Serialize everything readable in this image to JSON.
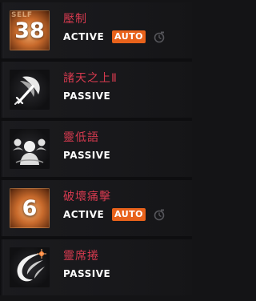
{
  "skills": [
    {
      "name": "壓制",
      "type": "ACTIVE",
      "auto": "AUTO",
      "icon": "self-counter-icon",
      "self_label": "SELF",
      "count": "38"
    },
    {
      "name": "諸天之上Ⅱ",
      "type": "PASSIVE",
      "icon": "sword-slash-icon"
    },
    {
      "name": "靈低語",
      "type": "PASSIVE",
      "icon": "spirit-whisper-icon"
    },
    {
      "name": "破壞痛擊",
      "type": "ACTIVE",
      "auto": "AUTO",
      "icon": "counter-icon",
      "count": "6"
    },
    {
      "name": "靈席捲",
      "type": "PASSIVE",
      "icon": "spirit-sweep-icon"
    }
  ],
  "colors": {
    "skill_name": "#d63a4f",
    "auto_badge": "#e8621b",
    "row_bg": "#1b1b1e",
    "page_bg": "#141416"
  }
}
